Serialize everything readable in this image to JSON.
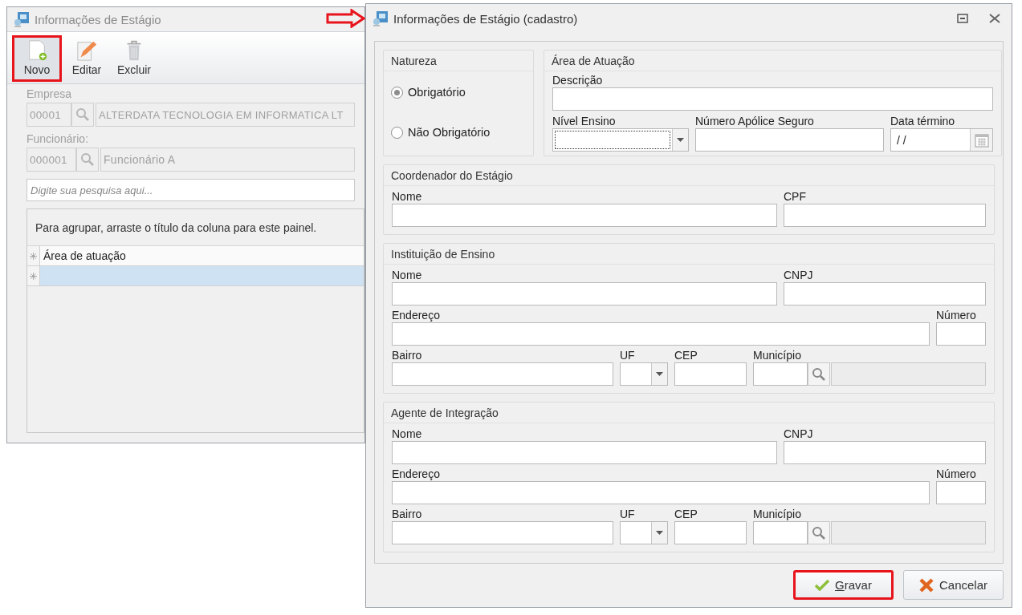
{
  "background_window": {
    "title": "Informações de Estágio",
    "toolbar": [
      {
        "kind": "new",
        "label": "Novo",
        "highlighted": true
      },
      {
        "kind": "edit",
        "label": "Editar",
        "highlighted": false
      },
      {
        "kind": "delete",
        "label": "Excluir",
        "highlighted": false
      }
    ],
    "fields": [
      {
        "label": "Empresa",
        "code": "00001",
        "value": "ALTERDATA TECNOLOGIA EM INFORMATICA LT"
      },
      {
        "label": "Funcionário:",
        "code": "000001",
        "value": "Funcionário A"
      }
    ],
    "search": {
      "placeholder": "Digite sua pesquisa aqui..."
    },
    "grid": {
      "group_hint": "Para agrupar, arraste o título da coluna para este painel.",
      "columns": [
        "Área de atuação"
      ],
      "rows": [
        {
          "selected": true
        }
      ]
    }
  },
  "dialog": {
    "title": "Informações de Estágio (cadastro)",
    "natureza": {
      "title": "Natureza",
      "options": [
        {
          "label": "Obrigatório",
          "selected": true
        },
        {
          "label": "Não Obrigatório",
          "selected": false
        }
      ]
    },
    "area": {
      "title": "Área de Atuação",
      "fields": [
        {
          "kind": "wide",
          "label": "Descrição"
        },
        {
          "kind": "combo",
          "label": "Nível Ensino",
          "focused": true
        },
        {
          "kind": "policy",
          "label": "Número Apólice Seguro"
        },
        {
          "kind": "date",
          "label": "Data término",
          "value": "/ /"
        }
      ]
    },
    "sections": [
      {
        "title": "Coordenador do Estágio",
        "fields": [
          {
            "kind": "text",
            "label": "Nome"
          },
          {
            "kind": "doc",
            "label": "CPF"
          }
        ]
      },
      {
        "title": "Instituição de Ensino",
        "fields": [
          {
            "kind": "text",
            "label": "Nome"
          },
          {
            "kind": "doc",
            "label": "CNPJ"
          },
          {
            "kind": "text",
            "label": "Endereço"
          },
          {
            "kind": "short",
            "label": "Número"
          },
          {
            "kind": "medium",
            "label": "Bairro"
          },
          {
            "kind": "uf",
            "label": "UF"
          },
          {
            "kind": "cep",
            "label": "CEP"
          },
          {
            "kind": "lookup",
            "label": "Município"
          }
        ]
      },
      {
        "title": "Agente de Integração",
        "fields": [
          {
            "kind": "text",
            "label": "Nome"
          },
          {
            "kind": "doc",
            "label": "CNPJ"
          },
          {
            "kind": "text",
            "label": "Endereço"
          },
          {
            "kind": "short",
            "label": "Número"
          },
          {
            "kind": "medium",
            "label": "Bairro"
          },
          {
            "kind": "uf",
            "label": "UF"
          },
          {
            "kind": "cep",
            "label": "CEP"
          },
          {
            "kind": "lookup",
            "label": "Município"
          }
        ]
      }
    ],
    "buttons": [
      {
        "kind": "save",
        "label": "Gravar",
        "highlighted": true
      },
      {
        "kind": "cancel",
        "label": "Cancelar",
        "highlighted": false
      }
    ]
  }
}
